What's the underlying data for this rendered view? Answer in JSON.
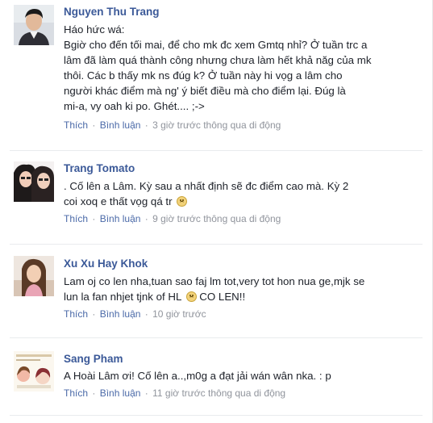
{
  "posts": [
    {
      "author": "Nguyen Thu Trang",
      "lines": [
        "Háo hức wá:",
        "Bgiờ cho đến tối mai, để cho mk đc xem Gmtq nhỉ? Ở tuần trc a",
        "lâm đã làm quá thành công nhưng chưa làm hết khả năg của mk",
        "thôi. Các b thấy mk ns đúg k? Ở tuần này hi vọg a lâm cho",
        "người khác điểm mà ng' ý biết điều mà cho điểm lại. Đúg là",
        "mi-a, vy oah ki po. Ghét.... ;->"
      ],
      "like_label": "Thích",
      "comment_label": "Bình luận",
      "time_text": "3 giờ trước thông qua di động"
    },
    {
      "author": "Trang Tomato",
      "lines": [
        ". Cố lên a Lâm. Kỳ sau a nhất định sẽ đc điểm cao mà. Kỳ 2",
        "coi xoq e thất vọg qá tr"
      ],
      "like_label": "Thích",
      "comment_label": "Bình luận",
      "time_text": "9 giờ trước thông qua di động"
    },
    {
      "author": "Xu Xu Hay Khok",
      "lines": [
        "Lam oj co len nha,tuan sao faj lm tot,very tot hon nua ge,mjk se",
        "lun la fan nhjet tjnk of HL",
        "CO LEN!!"
      ],
      "like_label": "Thích",
      "comment_label": "Bình luận",
      "time_text": "10 giờ trước"
    },
    {
      "author": "Sang Pham",
      "lines": [
        "A Hoài Lâm ơi! Cố lên a..,m0g a đạt jải wán wân nka. : p"
      ],
      "like_label": "Thích",
      "comment_label": "Bình luận",
      "time_text": "11 giờ trước thông qua di động"
    }
  ],
  "separator": "·",
  "emoticon_names": [
    "frown-emoticon-icon",
    "sad-emoticon-icon"
  ],
  "colors": {
    "author_link": "#3b5998",
    "action_link": "#4b6aa8",
    "meta_text": "#90949c",
    "body_text": "#1d2129"
  }
}
